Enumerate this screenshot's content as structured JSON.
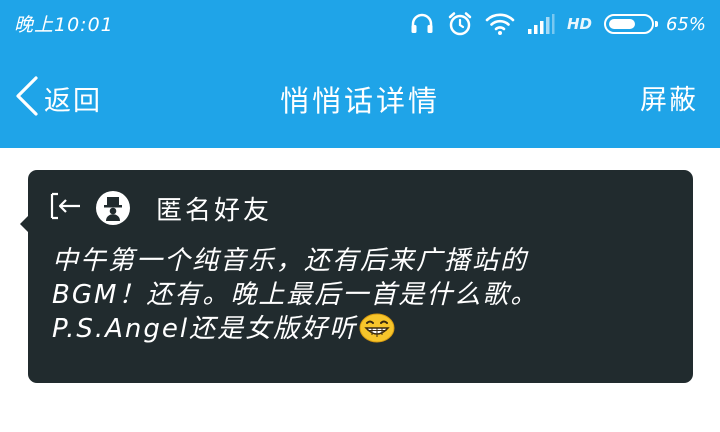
{
  "status_bar": {
    "time": "晚上10:01",
    "network_label": "HD",
    "battery_percent": "65%",
    "battery_level": 0.65,
    "icons": [
      "headphones-icon",
      "alarm-icon",
      "wifi-icon",
      "signal-icon",
      "battery-icon"
    ]
  },
  "nav": {
    "back_label": "返回",
    "title": "悄悄话详情",
    "block_label": "屏蔽"
  },
  "message": {
    "sender": "匿名好友",
    "lines": [
      "中午第一个纯音乐，还有后来广播站的",
      "BGM！还有。晚上最后一首是什么歌。",
      "P.S.Angel还是女版好听"
    ],
    "emoji": "grinning-face-emoji"
  },
  "colors": {
    "header_blue": "#1fa4e8",
    "card_background": "#212b2e",
    "page_background": "#ffffff",
    "emoji_yellow": "#f7c52b"
  }
}
